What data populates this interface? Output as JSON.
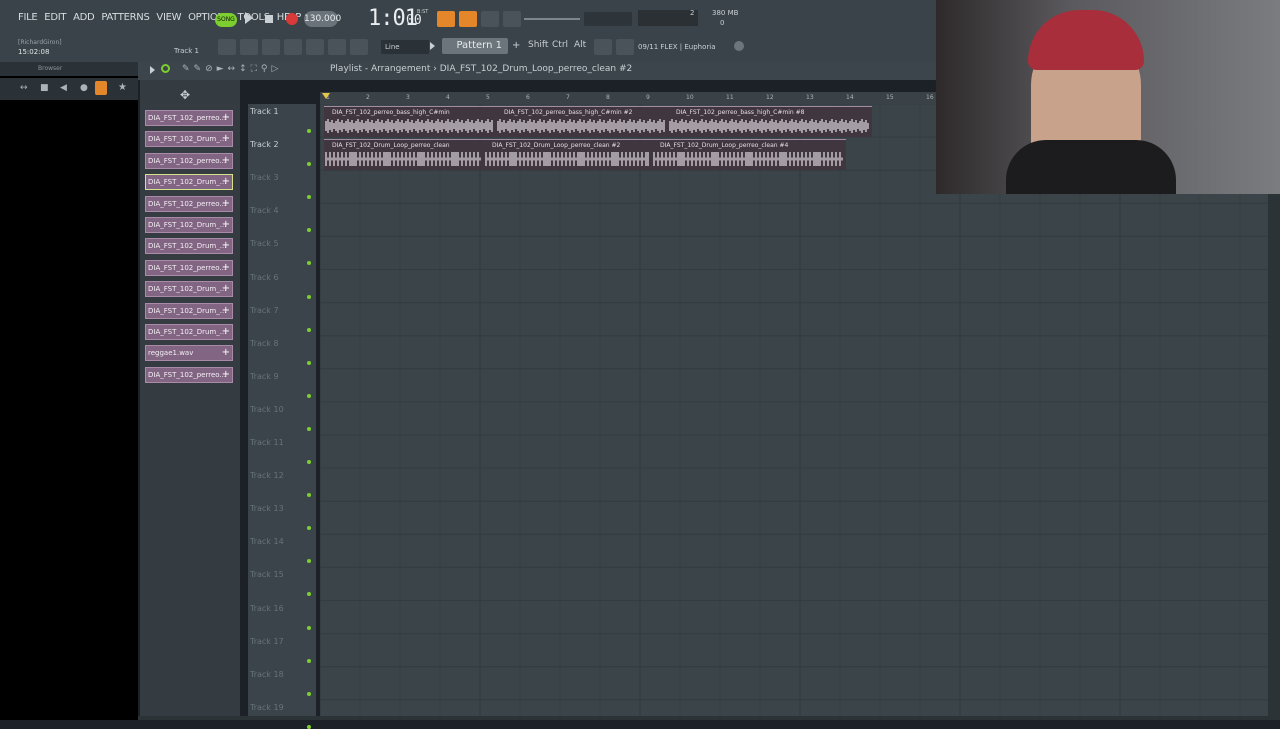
{
  "menu": {
    "items": [
      "FILE",
      "EDIT",
      "ADD",
      "PATTERNS",
      "VIEW",
      "OPTIONS",
      "TOOLS",
      "HELP"
    ]
  },
  "transport": {
    "song_label": "SONG",
    "tempo": "130.000",
    "time": "1:01",
    "time_sub": "00",
    "time_sub_label": "B:ST"
  },
  "info": {
    "user": "[RichardGiron]",
    "clock": "15:02:08",
    "track": "Track 1"
  },
  "meters": {
    "cpu_value": "2",
    "memory": "380 MB",
    "memory_sub": "0"
  },
  "toolbar": {
    "line_mode": "Line",
    "pattern": "Pattern 1",
    "key_shift": "Shift",
    "key_ctrl": "Ctrl",
    "key_alt": "Alt",
    "plugin_info": "09/11  FLEX | Euphoria"
  },
  "browser": {
    "label": "Browser"
  },
  "playlist": {
    "title": "Playlist - Arrangement",
    "current_clip": "DIA_FST_102_Drum_Loop_perreo_clean #2",
    "arrow": "›"
  },
  "picker_clips": [
    {
      "label": "DIA_FST_102_perreo..."
    },
    {
      "label": "DIA_FST_102_Drum_..."
    },
    {
      "label": "DIA_FST_102_perreo..."
    },
    {
      "label": "DIA_FST_102_Drum_..."
    },
    {
      "label": "DIA_FST_102_perreo..."
    },
    {
      "label": "DIA_FST_102_Drum_..."
    },
    {
      "label": "DIA_FST_102_Drum_..."
    },
    {
      "label": "DIA_FST_102_perreo..."
    },
    {
      "label": "DIA_FST_102_Drum_..."
    },
    {
      "label": "DIA_FST_102_Drum_..."
    },
    {
      "label": "DIA_FST_102_Drum_..."
    },
    {
      "label": "reggae1.wav"
    },
    {
      "label": "DIA_FST_102_perreo..."
    }
  ],
  "ruler": {
    "bars": [
      "1",
      "2",
      "3",
      "4",
      "5",
      "6",
      "7",
      "8",
      "9",
      "10",
      "11",
      "12",
      "13",
      "14",
      "15",
      "16"
    ]
  },
  "tracks": [
    "Track 1",
    "Track 2",
    "Track 3",
    "Track 4",
    "Track 5",
    "Track 6",
    "Track 7",
    "Track 8",
    "Track 9",
    "Track 10",
    "Track 11",
    "Track 12",
    "Track 13",
    "Track 14",
    "Track 15",
    "Track 16",
    "Track 17",
    "Track 18",
    "Track 19"
  ],
  "track1_clips": [
    {
      "name": "DIA_FST_102_perreo_bass_high_C#min"
    },
    {
      "name": "DIA_FST_102_perreo_bass_high_C#min #2"
    },
    {
      "name": "DIA_FST_102_perreo_bass_high_C#min #8"
    }
  ],
  "track2_clips": [
    {
      "name": "DIA_FST_102_Drum_Loop_perreo_clean"
    },
    {
      "name": "DIA_FST_102_Drum_Loop_perreo_clean #2"
    },
    {
      "name": "DIA_FST_102_Drum_Loop_perreo_clean #4"
    }
  ],
  "colors": {
    "clip": "#826583",
    "accent_green": "#7ccf2f",
    "record": "#d83a3a",
    "grid_bg": "#3a4449"
  }
}
